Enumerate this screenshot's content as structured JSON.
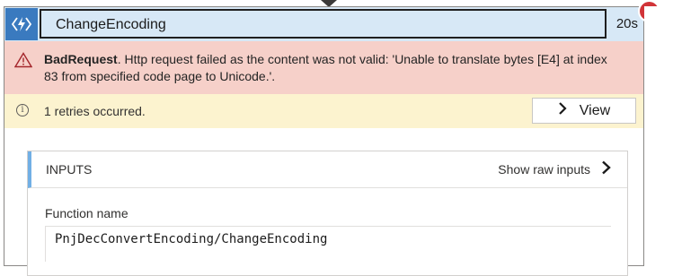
{
  "action": {
    "title": "ChangeEncoding",
    "duration": "20s",
    "icon": "azure-function-icon",
    "status_badge": "!"
  },
  "error": {
    "code": "BadRequest",
    "message": ". Http request failed as the content was not valid: 'Unable to translate bytes [E4] at index 83 from specified code page to Unicode.'."
  },
  "retry": {
    "text": "1 retries occurred.",
    "view_label": "View"
  },
  "inputs": {
    "section_title": "INPUTS",
    "raw_link_label": "Show raw inputs",
    "fields": [
      {
        "label": "Function name",
        "value": "PnjDecConvertEncoding/ChangeEncoding"
      }
    ]
  },
  "colors": {
    "header_bg": "#d7e8f6",
    "icon_bg": "#3a7abf",
    "error_bg": "#f6d0c9",
    "warning_bg": "#fcf3cf",
    "badge": "#d13438",
    "accent_bar": "#71afe5"
  }
}
